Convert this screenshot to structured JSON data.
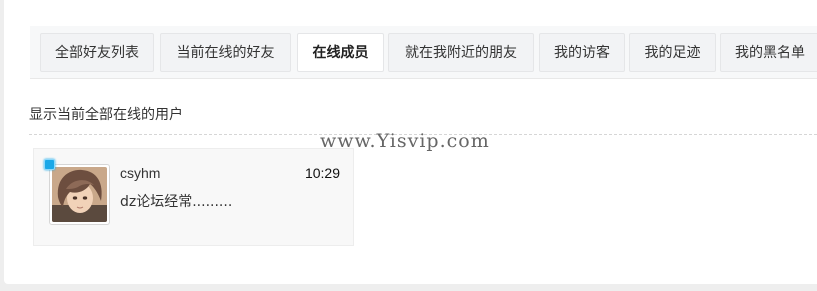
{
  "tabs": [
    {
      "label": "全部好友列表",
      "active": false
    },
    {
      "label": "当前在线的好友",
      "active": false
    },
    {
      "label": "在线成员",
      "active": true
    },
    {
      "label": "就在我附近的朋友",
      "active": false
    },
    {
      "label": "我的访客",
      "active": false
    },
    {
      "label": "我的足迹",
      "active": false
    },
    {
      "label": "我的黑名单",
      "active": false
    }
  ],
  "description": "显示当前全部在线的用户",
  "watermark": "www.Yisvip.com",
  "online_users": [
    {
      "name": "csyhm",
      "time": "10:29",
      "status": "dz论坛经常.........",
      "online_indicator_color": "#1aa8e8"
    }
  ]
}
